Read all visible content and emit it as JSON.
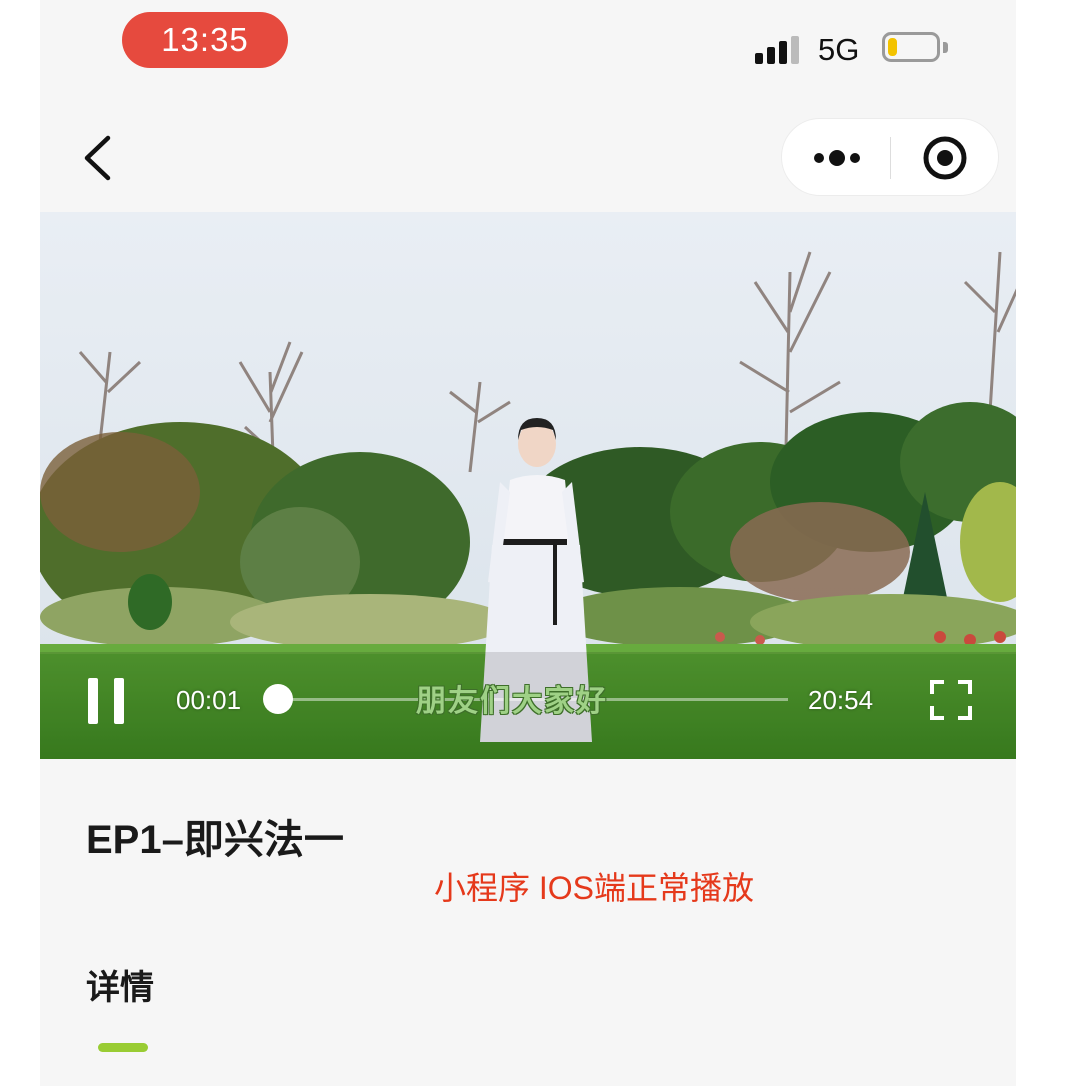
{
  "status_bar": {
    "time": "13:35",
    "network": "5G",
    "battery_level": 0.2,
    "time_pill_color": "#e64a3e"
  },
  "nav_bar": {
    "back_icon": "chevron-left-icon",
    "more_icon": "more-dots-icon",
    "close_icon": "target-circle-icon"
  },
  "video": {
    "current_time": "00:01",
    "duration": "20:54",
    "progress": 0.0,
    "subtitle": "朋友们大家好",
    "state": "playing"
  },
  "content": {
    "episode_title": "EP1–即兴法一",
    "note": "小程序 IOS端正常播放",
    "note_color": "#e5391b",
    "tabs": [
      {
        "label": "详情",
        "active": true
      }
    ],
    "accent_color": "#99cc33"
  }
}
